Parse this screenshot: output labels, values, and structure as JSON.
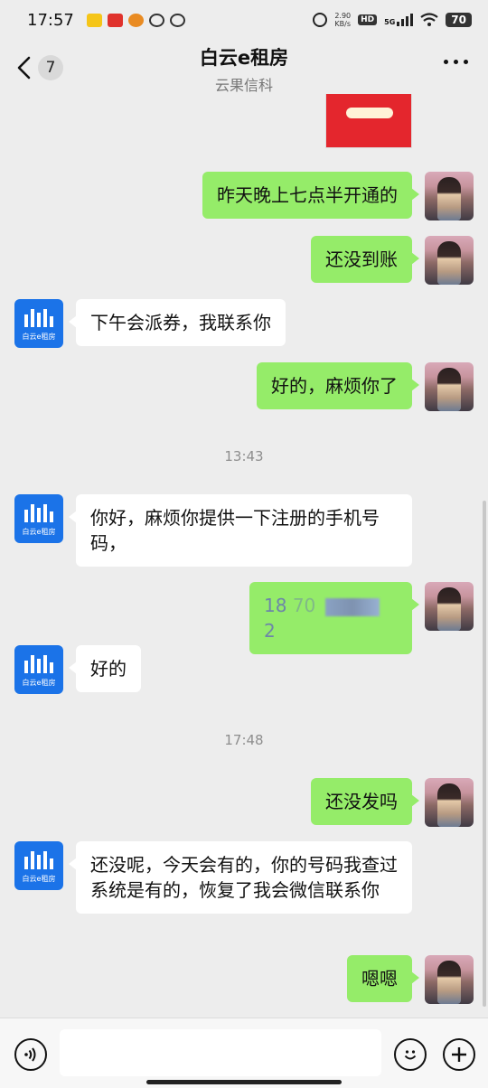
{
  "status_bar": {
    "time": "17:57",
    "net_speed_value": "2.90",
    "net_speed_unit": "KB/s",
    "hd_label": "HD",
    "network_label": "5G",
    "battery_label": "70"
  },
  "header": {
    "back_count": "7",
    "title": "白云e租房",
    "subtitle": "云果信科"
  },
  "brand_avatar_text": "白云e租房",
  "messages": [
    {
      "text": "昨天晚上七点半开通的"
    },
    {
      "text": "还没到账"
    },
    {
      "text": "下午会派券，我联系你"
    },
    {
      "text": "好的，麻烦你了"
    },
    {
      "text": "13:43"
    },
    {
      "text": "你好，麻烦你提供一下注册的手机号码，"
    },
    {
      "text_prefix": "18",
      "text_mid": "70",
      "text_suffix": "2"
    },
    {
      "text": "好的"
    },
    {
      "text": "17:48"
    },
    {
      "text": "还没发吗"
    },
    {
      "text": "还没呢，今天会有的，你的号码我查过系统是有的，恢复了我会微信联系你"
    },
    {
      "text": "嗯嗯"
    }
  ]
}
